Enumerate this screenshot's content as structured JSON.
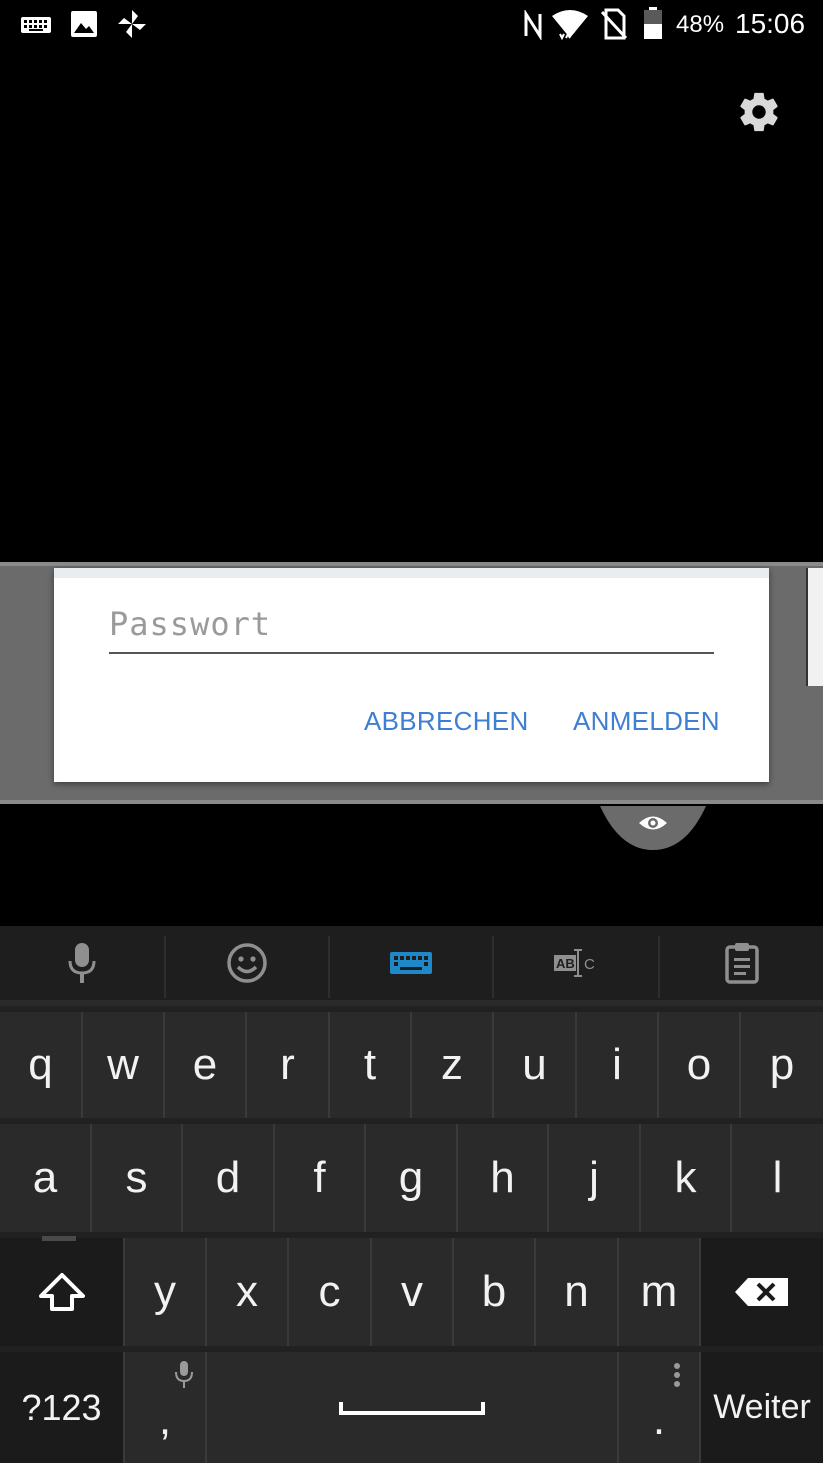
{
  "status_bar": {
    "battery_percent": "48%",
    "time": "15:06",
    "left_icons": [
      "keyboard-icon",
      "image-icon",
      "pinwheel-icon"
    ],
    "right_icons": [
      "nfc-icon",
      "wifi-icon",
      "no-sim-icon",
      "battery-icon"
    ]
  },
  "dialog": {
    "password_placeholder": "Passwort",
    "cancel_label": "ABBRECHEN",
    "login_label": "ANMELDEN"
  },
  "keyboard": {
    "toolbar": [
      "mic-icon",
      "emoji-icon",
      "keyboard-icon",
      "text-select-icon",
      "clipboard-icon"
    ],
    "row1": [
      "q",
      "w",
      "e",
      "r",
      "t",
      "z",
      "u",
      "i",
      "o",
      "p"
    ],
    "row2": [
      "a",
      "s",
      "d",
      "f",
      "g",
      "h",
      "j",
      "k",
      "l"
    ],
    "row3": [
      "y",
      "x",
      "c",
      "v",
      "b",
      "n",
      "m"
    ],
    "symbols_label": "?123",
    "comma_label": ",",
    "period_label": ".",
    "action_label": "Weiter"
  },
  "colors": {
    "accent": "#3f7fd3",
    "keyboard_active_icon": "#1e88c8",
    "keyboard_key": "#2a2a2a",
    "dialog_background": "#ffffff"
  }
}
